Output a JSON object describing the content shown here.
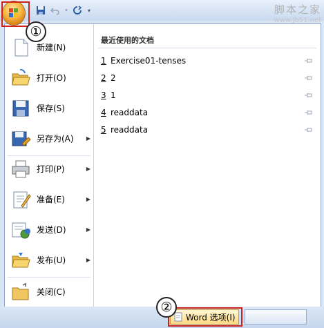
{
  "watermark": {
    "line1": "脚本之家",
    "line2": "www.Jb51.net"
  },
  "callouts": {
    "one": "①",
    "two": "②"
  },
  "menu": {
    "items": [
      {
        "label": "新建(N)",
        "icon": "new-document-icon",
        "submenu": false
      },
      {
        "label": "打开(O)",
        "icon": "open-folder-icon",
        "submenu": false
      },
      {
        "label": "保存(S)",
        "icon": "save-disk-icon",
        "submenu": false
      },
      {
        "label": "另存为(A)",
        "icon": "save-as-icon",
        "submenu": true
      },
      {
        "label": "打印(P)",
        "icon": "printer-icon",
        "submenu": true
      },
      {
        "label": "准备(E)",
        "icon": "prepare-icon",
        "submenu": true
      },
      {
        "label": "发送(D)",
        "icon": "send-icon",
        "submenu": true
      },
      {
        "label": "发布(U)",
        "icon": "publish-icon",
        "submenu": true
      },
      {
        "label": "关闭(C)",
        "icon": "close-folder-icon",
        "submenu": false
      }
    ]
  },
  "recent": {
    "title": "最近使用的文档",
    "documents": [
      {
        "num": "1",
        "name": "Exercise01-tenses"
      },
      {
        "num": "2",
        "name": "2"
      },
      {
        "num": "3",
        "name": "1"
      },
      {
        "num": "4",
        "name": "readdata"
      },
      {
        "num": "5",
        "name": "readdata"
      }
    ]
  },
  "footer": {
    "options_label": "Word 选项(I)"
  }
}
